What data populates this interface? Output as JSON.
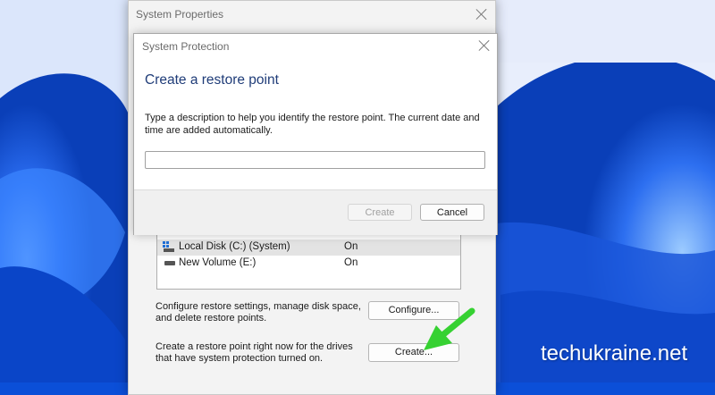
{
  "colors": {
    "wallpaper": "#0b4fd8",
    "heading": "#1f3c78",
    "arrow": "#36d132",
    "window_bg": "#f3f3f3"
  },
  "system_properties": {
    "title": "System Properties",
    "drives": [
      {
        "name": "Local Disk (C:) (System)",
        "protection": "On",
        "icon": "system-drive-icon"
      },
      {
        "name": "New Volume (E:)",
        "protection": "On",
        "icon": "drive-icon"
      }
    ],
    "configure_text": "Configure restore settings, manage disk space, and delete restore points.",
    "configure_button": "Configure...",
    "create_text": "Create a restore point right now for the drives that have system protection turned on.",
    "create_button": "Create..."
  },
  "system_protection": {
    "title": "System Protection",
    "heading": "Create a restore point",
    "description": "Type a description to help you identify the restore point. The current date and time are added automatically.",
    "input_value": "",
    "create_button": "Create",
    "cancel_button": "Cancel"
  },
  "watermark": "techukraine.net"
}
